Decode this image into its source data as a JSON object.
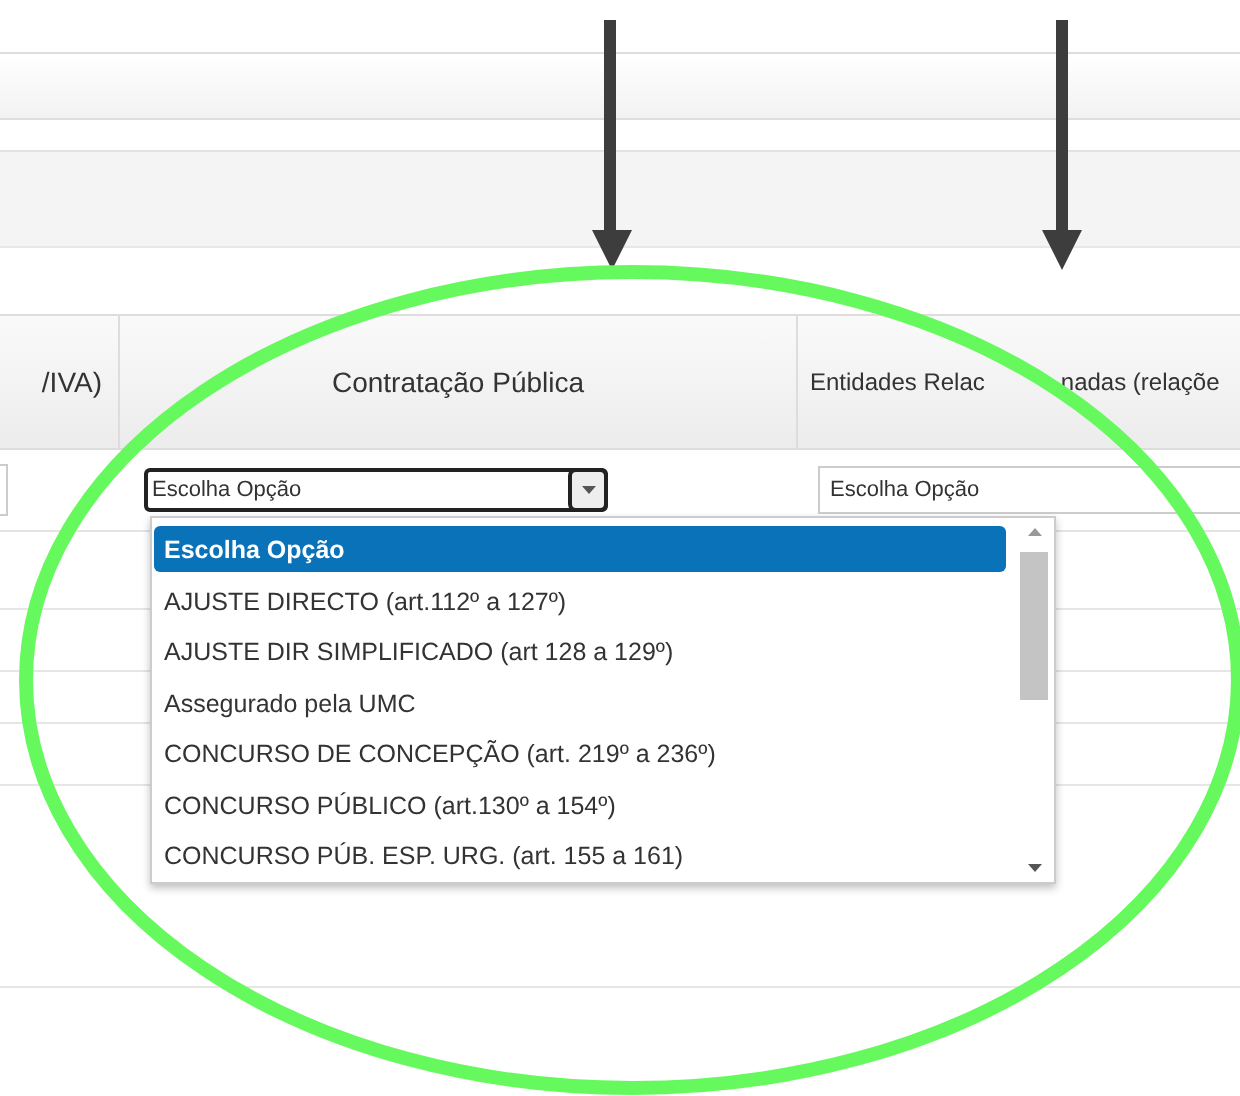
{
  "table": {
    "columns": [
      "/IVA)",
      "Contratação Pública",
      {
        "visible_parts": [
          "Entidades Relac",
          "nadas (relaçõe"
        ]
      }
    ],
    "row": {
      "contratacao_value": "Escolha Opção",
      "entidades_value": "Escolha Opção"
    }
  },
  "dropdown": {
    "items": [
      {
        "label": "Escolha Opção",
        "selected": true
      },
      {
        "label": "AJUSTE DIRECTO (art.112º a 127º)",
        "selected": false
      },
      {
        "label": "AJUSTE DIR SIMPLIFICADO (art 128 a 129º)",
        "selected": false
      },
      {
        "label": "Assegurado pela UMC",
        "selected": false
      },
      {
        "label": "CONCURSO DE CONCEPÇÃO (art. 219º a 236º)",
        "selected": false
      },
      {
        "label": "CONCURSO PÚBLICO (art.130º a 154º)",
        "selected": false
      },
      {
        "label": "CONCURSO PÚB. ESP. URG. (art. 155 a 161)",
        "selected": false
      }
    ]
  }
}
